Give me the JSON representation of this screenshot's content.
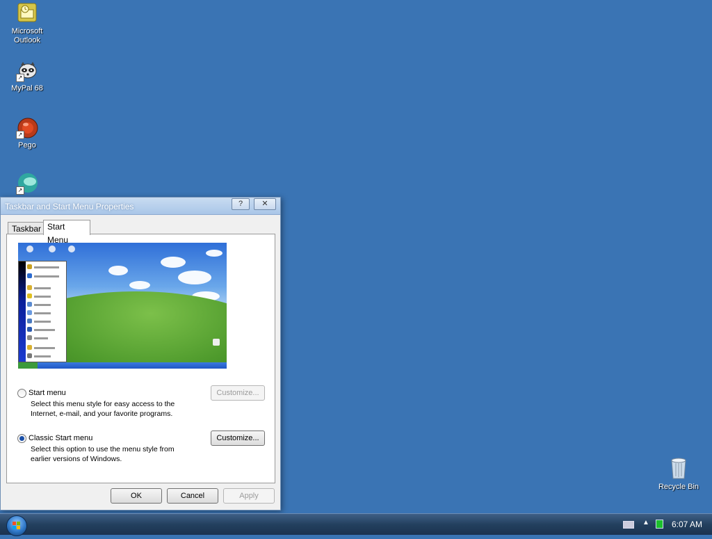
{
  "desktop": {
    "icons": [
      {
        "label": "Microsoft Outlook"
      },
      {
        "label": "MyPal 68"
      },
      {
        "label": "Pego"
      },
      {
        "label": ""
      }
    ],
    "recycle_bin_label": "Recycle Bin"
  },
  "dialog": {
    "title": "Taskbar and Start Menu Properties",
    "help_button": "?",
    "close_button": "✕",
    "tabs": [
      {
        "label": "Taskbar",
        "active": false
      },
      {
        "label": "Start Menu",
        "active": true
      }
    ],
    "options": [
      {
        "label": "Start menu",
        "description": "Select this menu style for easy access to the Internet, e-mail, and your favorite programs.",
        "selected": false,
        "customize_label": "Customize...",
        "customize_enabled": false
      },
      {
        "label": "Classic Start menu",
        "description": "Select this option to use the menu style from earlier versions of Windows.",
        "selected": true,
        "customize_label": "Customize...",
        "customize_enabled": true
      }
    ],
    "buttons": {
      "ok": "OK",
      "cancel": "Cancel",
      "apply": "Apply"
    }
  },
  "taskbar": {
    "clock": "6:07 AM",
    "tray_expand": "▲"
  },
  "colors": {
    "desktop_bg": "#3a74b4",
    "taskbar_bg": "#23405f",
    "selection": "#1a4fa8"
  }
}
